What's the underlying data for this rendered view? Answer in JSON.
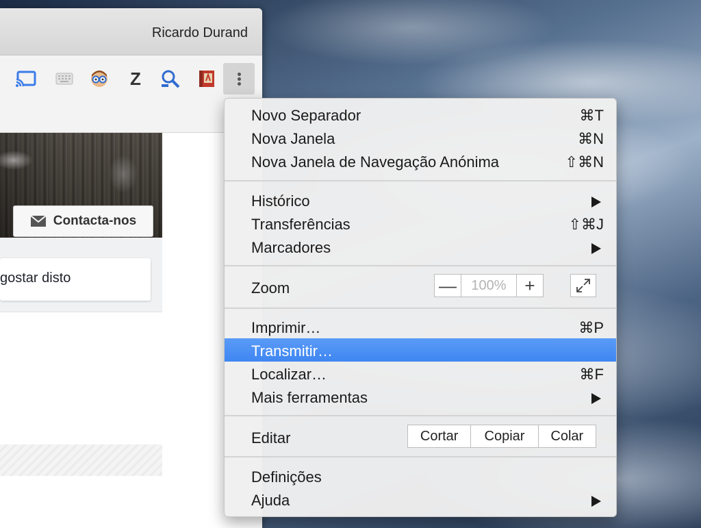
{
  "window": {
    "profile_name": "Ricardo Durand"
  },
  "toolbar": {
    "icons": [
      {
        "name": "cast-icon"
      },
      {
        "name": "keyboard-icon"
      },
      {
        "name": "reader-avatar-icon"
      },
      {
        "name": "zotero-icon",
        "glyph": "Z"
      },
      {
        "name": "search-zoom-icon"
      },
      {
        "name": "book-icon"
      }
    ],
    "menu_button": "more-options"
  },
  "page": {
    "contact_button": "Contacta-nos",
    "like_text": "gostar disto"
  },
  "menu": {
    "groups": [
      {
        "items": [
          {
            "label": "Novo Separador",
            "shortcut": "⌘T"
          },
          {
            "label": "Nova Janela",
            "shortcut": "⌘N"
          },
          {
            "label": "Nova Janela de Navegação Anónima",
            "shortcut": "⇧⌘N"
          }
        ]
      },
      {
        "items": [
          {
            "label": "Histórico",
            "submenu": true
          },
          {
            "label": "Transferências",
            "shortcut": "⇧⌘J"
          },
          {
            "label": "Marcadores",
            "submenu": true
          }
        ]
      },
      {
        "zoom": {
          "label": "Zoom",
          "minus": "—",
          "value": "100%",
          "plus": "+"
        }
      },
      {
        "items": [
          {
            "label": "Imprimir…",
            "shortcut": "⌘P"
          },
          {
            "label": "Transmitir…",
            "selected": true
          },
          {
            "label": "Localizar…",
            "shortcut": "⌘F"
          },
          {
            "label": "Mais ferramentas",
            "submenu": true
          }
        ]
      },
      {
        "edit": {
          "label": "Editar",
          "cut": "Cortar",
          "copy": "Copiar",
          "paste": "Colar"
        }
      },
      {
        "items": [
          {
            "label": "Definições"
          },
          {
            "label": "Ajuda",
            "submenu": true
          }
        ]
      }
    ]
  },
  "colors": {
    "highlight": "#4a90f4",
    "menu_bg": "#f0f0f0"
  }
}
